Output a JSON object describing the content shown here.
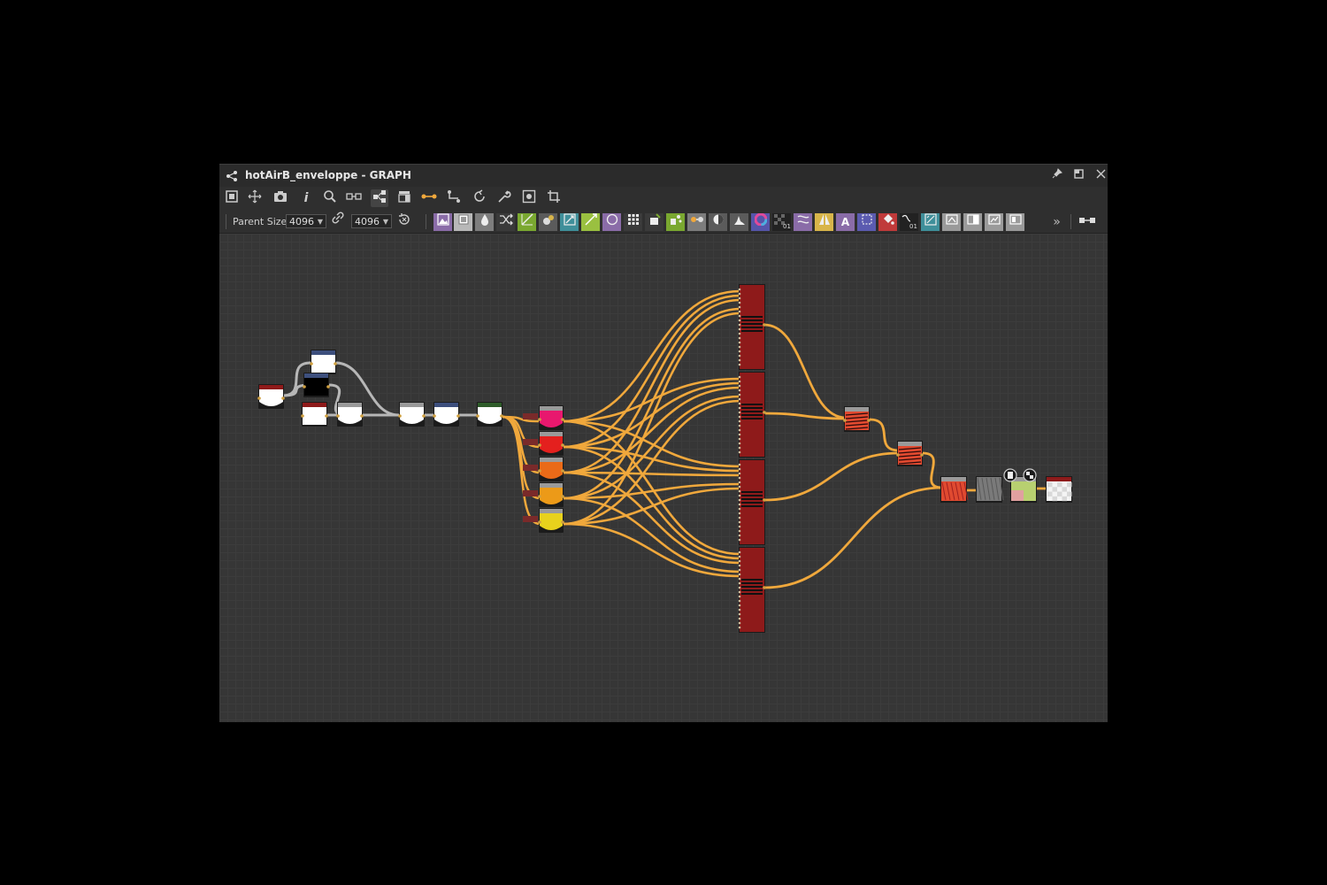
{
  "window": {
    "title": "hotAirB_enveloppe - GRAPH",
    "icon": "graph-icon",
    "controls": [
      "pin-icon",
      "maximize-icon",
      "close-icon"
    ]
  },
  "toolbar": {
    "icons": [
      "frame-all-icon",
      "pan-icon",
      "screenshot-icon",
      "info-icon",
      "search-icon",
      "align-icon",
      "graph-layout-icon",
      "node-stack-icon",
      "link-icon",
      "connector-icon",
      "refresh-icon",
      "tools-icon",
      "preview-icon",
      "crop-icon"
    ]
  },
  "parent_size": {
    "label": "Parent Size:",
    "width": "4096",
    "height": "4096",
    "link_icon": "link-icon",
    "reset_icon": "reset-icon"
  },
  "library": {
    "more": "»",
    "text_glyph": "A",
    "zero_one": "01",
    "colors": {
      "purple": "#8a6ca8",
      "grey": "#7d7d7d",
      "green": "#7aa830",
      "teal": "#3f8f9a",
      "yellow": "#d8b54a",
      "red": "#c03a3a"
    }
  },
  "graph": {
    "node_colors": {
      "red": "#8e1a1a",
      "pink": "#e8186e",
      "scarlet": "#e4201e",
      "orange": "#ea6a18",
      "amber": "#ec9a18",
      "yellow": "#e8d21c",
      "link_orange": "#f0a83c",
      "link_grey": "#b7b7b7",
      "header_blue": "#3d4f7d",
      "header_green": "#2f5d2a"
    }
  }
}
